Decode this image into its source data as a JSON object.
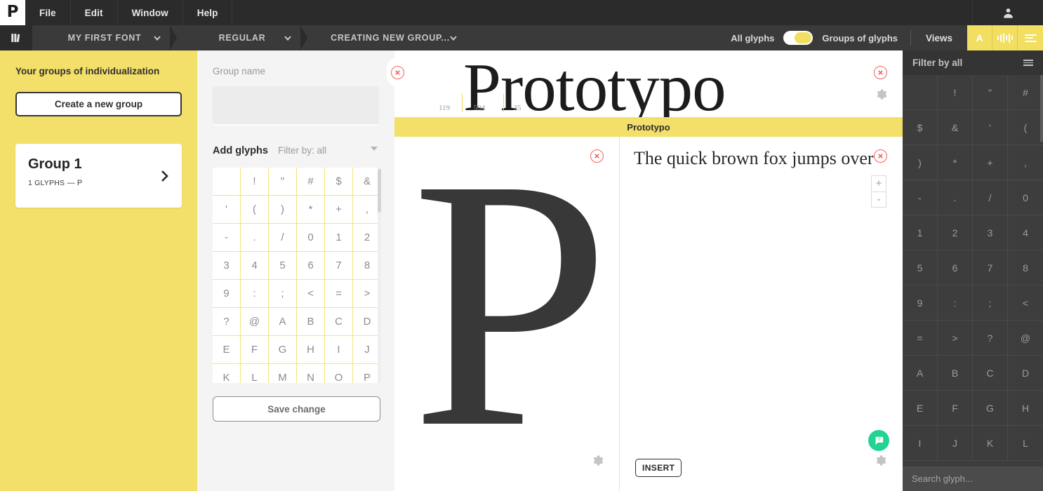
{
  "app": {
    "logo": "P",
    "accent_yellow": "#f3e06a",
    "dark": "#2b2b2b",
    "red": "#f4625e",
    "green": "#24d393"
  },
  "menubar": {
    "items": [
      "File",
      "Edit",
      "Window",
      "Help"
    ],
    "account_icon": "user-icon"
  },
  "tabbar": {
    "books_icon": "books-icon",
    "font_name": "MY FIRST FONT",
    "weight": "REGULAR",
    "group_tab": "CREATING NEW GROUP...",
    "toggle_left_label": "All glyphs",
    "toggle_right_label": "Groups of glyphs",
    "toggle_state": "right",
    "views_label": "Views",
    "view_buttons": [
      "A",
      "spacing-waveform-icon",
      "text-lines-icon"
    ]
  },
  "sidebar": {
    "title": "Your groups of individualization",
    "create_button": "Create a new group",
    "groups": [
      {
        "name": "Group 1",
        "count": "1 GLYPHS",
        "dash": "—",
        "glyphs": "P"
      }
    ]
  },
  "group_panel": {
    "name_label": "Group name",
    "name_value": "",
    "name_placeholder": "",
    "add_glyphs_label": "Add glyphs",
    "filter_label": "Filter by: all",
    "save_label": "Save change",
    "glyphs": [
      " ",
      "!",
      "\"",
      "#",
      "$",
      "&",
      "'",
      "(",
      ")",
      "*",
      "+",
      ",",
      "-",
      ".",
      "/",
      "0",
      "1",
      "2",
      "3",
      "4",
      "5",
      "6",
      "7",
      "8",
      "9",
      ":",
      ";",
      "<",
      "=",
      ">",
      "?",
      "@",
      "A",
      "B",
      "C",
      "D",
      "E",
      "F",
      "G",
      "H",
      "I",
      "J",
      "K",
      "L",
      "M",
      "N",
      "O",
      "P"
    ]
  },
  "canvas": {
    "word": "Prototypo",
    "spacing_values": [
      "119",
      "594",
      "35"
    ],
    "band_label": "Prototypo",
    "big_glyph": "P",
    "pangram": "The quick brown fox jumps over",
    "zoom_in": "+",
    "zoom_out": "-",
    "insert_label": "INSERT",
    "help_icon": "help-chat-icon",
    "gear_icon": "gear-icon",
    "close_icon": "close-circle-icon"
  },
  "right_panel": {
    "filter_title": "Filter by all",
    "menu_icon": "hamburger-icon",
    "search_placeholder": "Search glyph...",
    "search_value": "",
    "pin_icon": "pin-icon",
    "glyphs": [
      " ",
      "!",
      "\"",
      "#",
      "$",
      "&",
      "'",
      "(",
      ")",
      "*",
      "+",
      ",",
      "-",
      ".",
      "/",
      "0",
      "1",
      "2",
      "3",
      "4",
      "5",
      "6",
      "7",
      "8",
      "9",
      ":",
      ";",
      "<",
      "=",
      ">",
      "?",
      "@",
      "A",
      "B",
      "C",
      "D",
      "E",
      "F",
      "G",
      "H",
      "I",
      "J",
      "K",
      "L"
    ]
  }
}
